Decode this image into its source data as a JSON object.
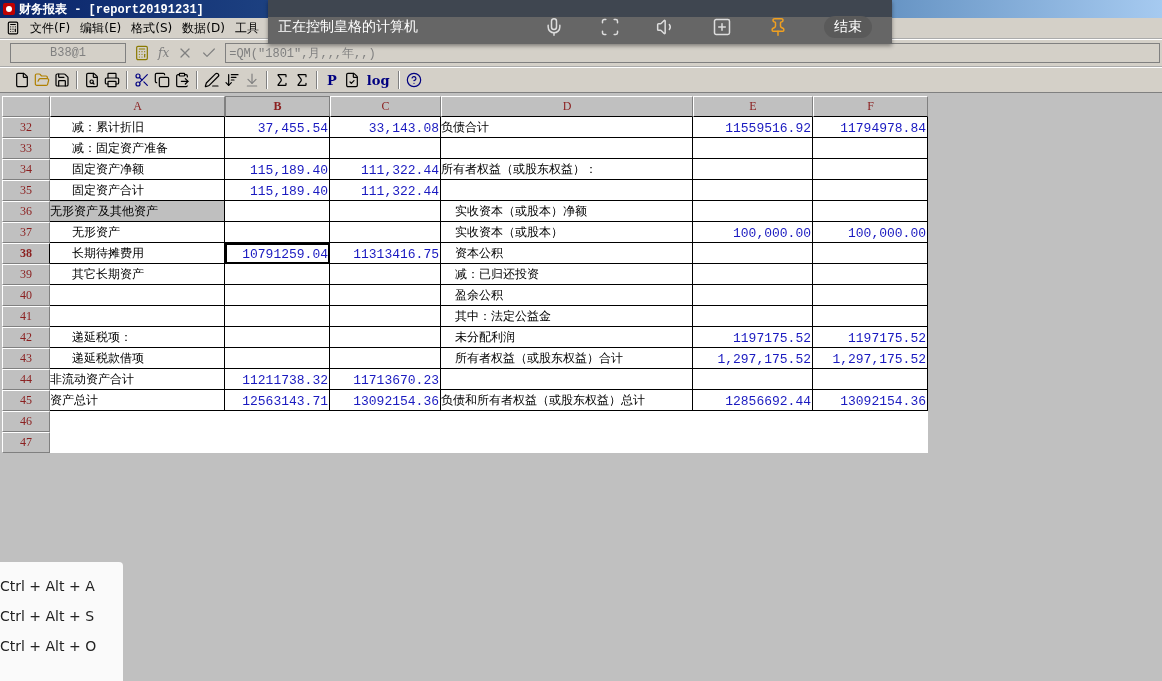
{
  "window": {
    "title": "财务报表 - [report20191231]"
  },
  "menu": [
    "文件(F)",
    "编辑(E)",
    "格式(S)",
    "数据(D)",
    "工具"
  ],
  "formula_bar": {
    "cell_ref": "B38@1",
    "fx": "fx",
    "formula": "=QM(\"1801\",月,,,年,,)"
  },
  "toolbar": {
    "labels": [
      "P",
      "log"
    ]
  },
  "columns": [
    {
      "label": "A",
      "selected": false
    },
    {
      "label": "B",
      "selected": true
    },
    {
      "label": "C",
      "selected": false
    },
    {
      "label": "D",
      "selected": false
    },
    {
      "label": "E",
      "selected": false
    },
    {
      "label": "F",
      "selected": false
    }
  ],
  "rows": [
    {
      "number": "32",
      "kind": "data",
      "selected": false,
      "label": {
        "text": "减：累计折旧",
        "indent": true,
        "highlighted": false
      },
      "b": "37,455.54",
      "c": "33,143.08",
      "item": {
        "text": "负债合计",
        "indent": false
      },
      "e": "11559516.92",
      "f": "11794978.84"
    },
    {
      "number": "33",
      "kind": "data",
      "selected": false,
      "label": {
        "text": "减：固定资产准备",
        "indent": true,
        "highlighted": false
      }
    },
    {
      "number": "34",
      "kind": "data",
      "selected": false,
      "label": {
        "text": "固定资产净额",
        "indent": true,
        "highlighted": false
      },
      "b": "115,189.40",
      "c": "111,322.44",
      "item": {
        "text": "所有者权益（或股东权益）：",
        "indent": false
      }
    },
    {
      "number": "35",
      "kind": "data",
      "selected": false,
      "label": {
        "text": "固定资产合计",
        "indent": true,
        "highlighted": false
      },
      "b": "115,189.40",
      "c": "111,322.44"
    },
    {
      "number": "36",
      "kind": "data",
      "selected": false,
      "label": {
        "text": "无形资产及其他资产",
        "indent": false,
        "highlighted": true
      },
      "item": {
        "text": "实收资本（或股本）净额",
        "indent": true
      }
    },
    {
      "number": "37",
      "kind": "data",
      "selected": false,
      "label": {
        "text": "无形资产",
        "indent": true,
        "highlighted": false
      },
      "item": {
        "text": "实收资本（或股本）",
        "indent": true
      },
      "e": "100,000.00",
      "f": "100,000.00"
    },
    {
      "number": "38",
      "kind": "data",
      "selected": true,
      "label": {
        "text": "长期待摊费用",
        "indent": true,
        "highlighted": false
      },
      "b": "10791259.04",
      "c": "11313416.75",
      "item": {
        "text": "资本公积",
        "indent": true
      }
    },
    {
      "number": "39",
      "kind": "data",
      "selected": false,
      "label": {
        "text": "其它长期资产",
        "indent": true,
        "highlighted": false
      },
      "item": {
        "text": "减：已归还投资",
        "indent": true
      }
    },
    {
      "number": "40",
      "kind": "data",
      "selected": false,
      "item": {
        "text": "盈余公积",
        "indent": true
      }
    },
    {
      "number": "41",
      "kind": "data",
      "selected": false,
      "item": {
        "text": "其中：法定公益金",
        "indent": true
      }
    },
    {
      "number": "42",
      "kind": "data",
      "selected": false,
      "label": {
        "text": "递延税项：",
        "indent": true,
        "highlighted": false
      },
      "item": {
        "text": "未分配利润",
        "indent": true
      },
      "e": "1197175.52",
      "f": "1197175.52"
    },
    {
      "number": "43",
      "kind": "data",
      "selected": false,
      "label": {
        "text": "递延税款借项",
        "indent": true,
        "highlighted": false
      },
      "item": {
        "text": "所有者权益（或股东权益）合计",
        "indent": true
      },
      "e": "1,297,175.52",
      "f": "1,297,175.52"
    },
    {
      "number": "44",
      "kind": "data",
      "selected": false,
      "label": {
        "text": "非流动资产合计",
        "indent": false,
        "highlighted": false
      },
      "b": "11211738.32",
      "c": "11713670.23"
    },
    {
      "number": "45",
      "kind": "data",
      "selected": false,
      "label": {
        "text": "资产总计",
        "indent": false,
        "highlighted": false
      },
      "b": "12563143.71",
      "c": "13092154.36",
      "item": {
        "text": "负债和所有者权益（或股东权益）总计",
        "indent": false
      },
      "e": "12856692.44",
      "f": "13092154.36"
    },
    {
      "number": "46",
      "kind": "empty",
      "selected": false
    },
    {
      "number": "47",
      "kind": "empty",
      "selected": false
    }
  ],
  "remote_bar": {
    "title": "正在控制皇格的计算机",
    "end_button": "结束"
  },
  "shortcuts": [
    "Ctrl + Alt + A",
    "Ctrl + Alt + S",
    "Ctrl + Alt + O"
  ]
}
